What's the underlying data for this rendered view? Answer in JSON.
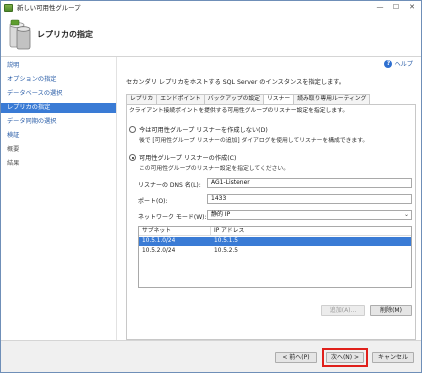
{
  "window": {
    "title": "新しい可用性グループ"
  },
  "header": {
    "title": "レプリカの指定"
  },
  "help": {
    "label": "ヘルプ"
  },
  "nav": {
    "items": [
      {
        "label": "説明",
        "state": "link"
      },
      {
        "label": "オプションの指定",
        "state": "link"
      },
      {
        "label": "データベースの選択",
        "state": "link"
      },
      {
        "label": "レプリカの指定",
        "state": "active"
      },
      {
        "label": "データ同期の選択",
        "state": "link"
      },
      {
        "label": "検証",
        "state": "link"
      },
      {
        "label": "概要",
        "state": "muted"
      },
      {
        "label": "結果",
        "state": "muted"
      }
    ]
  },
  "content": {
    "instruction": "セカンダリ レプリカをホストする SQL Server のインスタンスを指定します。",
    "tabs": [
      "レプリカ",
      "エンドポイント",
      "バックアップの設定",
      "リスナー",
      "読み取り専用ルーティング"
    ],
    "active_tab": "リスナー",
    "tab_description": "クライアント接続ポイントを提供する可用性グループのリスナー設定を指定します。",
    "option_no_listener": {
      "label": "今は可用性グループ リスナーを作成しない(D)",
      "sub": "後で [可用性グループ リスナーの追加] ダイアログを使用してリスナーを構成できます。",
      "checked": false
    },
    "option_create_listener": {
      "label": "可用性グループ リスナーの作成(C)",
      "sub": "この可用性グループのリスナー設定を指定してください。",
      "checked": true
    },
    "fields": {
      "dns_label": "リスナーの DNS 名(L):",
      "dns_value": "AG1-Listener",
      "port_label": "ポート(O):",
      "port_value": "1433",
      "network_label": "ネットワーク モード(W):",
      "network_value": "静的 IP"
    },
    "grid": {
      "headers": [
        "サブネット",
        "IP アドレス"
      ],
      "rows": [
        {
          "subnet": "10.5.1.0/24",
          "ip": "10.5.1.5",
          "selected": true
        },
        {
          "subnet": "10.5.2.0/24",
          "ip": "10.5.2.5",
          "selected": false
        }
      ]
    },
    "add_button": "追加(A)...",
    "remove_button": "削除(M)"
  },
  "footer": {
    "back": "< 前へ(P)",
    "next": "次へ(N) >",
    "cancel": "キャンセル"
  },
  "colors": {
    "accent": "#3a7bd5",
    "link": "#2b5ea8",
    "highlight": "#e0201b"
  }
}
